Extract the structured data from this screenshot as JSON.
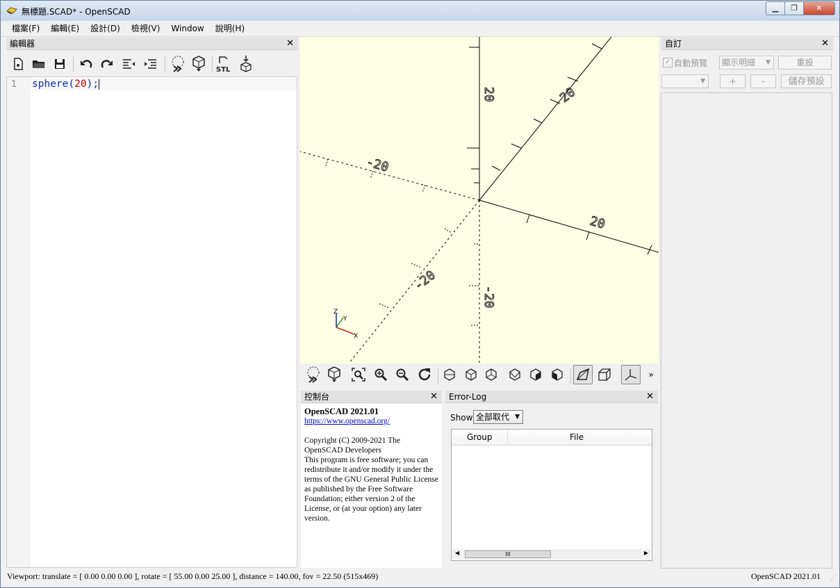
{
  "window": {
    "title": "無標題.SCAD* - OpenSCAD"
  },
  "menubar": [
    "檔案(F)",
    "編輯(E)",
    "設計(D)",
    "檢視(V)",
    "Window",
    "說明(H)"
  ],
  "editor": {
    "panel_title": "編輯器",
    "line_number": "1",
    "code": {
      "fn": "sphere",
      "open": "(",
      "arg": "20",
      "close": ");"
    }
  },
  "viewport": {
    "axis_labels": [
      "20",
      "20",
      "20",
      "-20",
      "-20",
      "-20"
    ],
    "gizmo": {
      "z": "Z",
      "y": "Y",
      "x": "X"
    }
  },
  "console": {
    "panel_title": "控制台",
    "heading": "OpenSCAD 2021.01",
    "link": "https://www.openscad.org/",
    "copyright": "Copyright (C) 2009-2021 The OpenSCAD Developers",
    "license": "This program is free software; you can redistribute it and/or modify it under the terms of the GNU General Public License as published by the Free Software Foundation; either version 2 of the License, or (at your option) any later version."
  },
  "errorlog": {
    "panel_title": "Error-Log",
    "show_label": "Show",
    "show_value": "全部取代",
    "columns": [
      "Group",
      "File"
    ],
    "scroll_thumb": "III"
  },
  "customizer": {
    "panel_title": "自訂",
    "auto_preview": "自動預覽",
    "detail_dropdown": "顯示明細",
    "reset_button": "重設",
    "plus_button": "+",
    "minus_button": "-",
    "save_preset_button": "儲存預設"
  },
  "statusbar": {
    "viewport_info": "Viewport: translate = [ 0.00 0.00 0.00 ], rotate = [ 55.00 0.00 25.00 ], distance = 140.00, fov = 22.50 (515x469)",
    "version": "OpenSCAD 2021.01"
  },
  "colors": {
    "viewport_bg": "#ffffe5",
    "keyword": "#0b2fa8",
    "number": "#cc0000"
  }
}
